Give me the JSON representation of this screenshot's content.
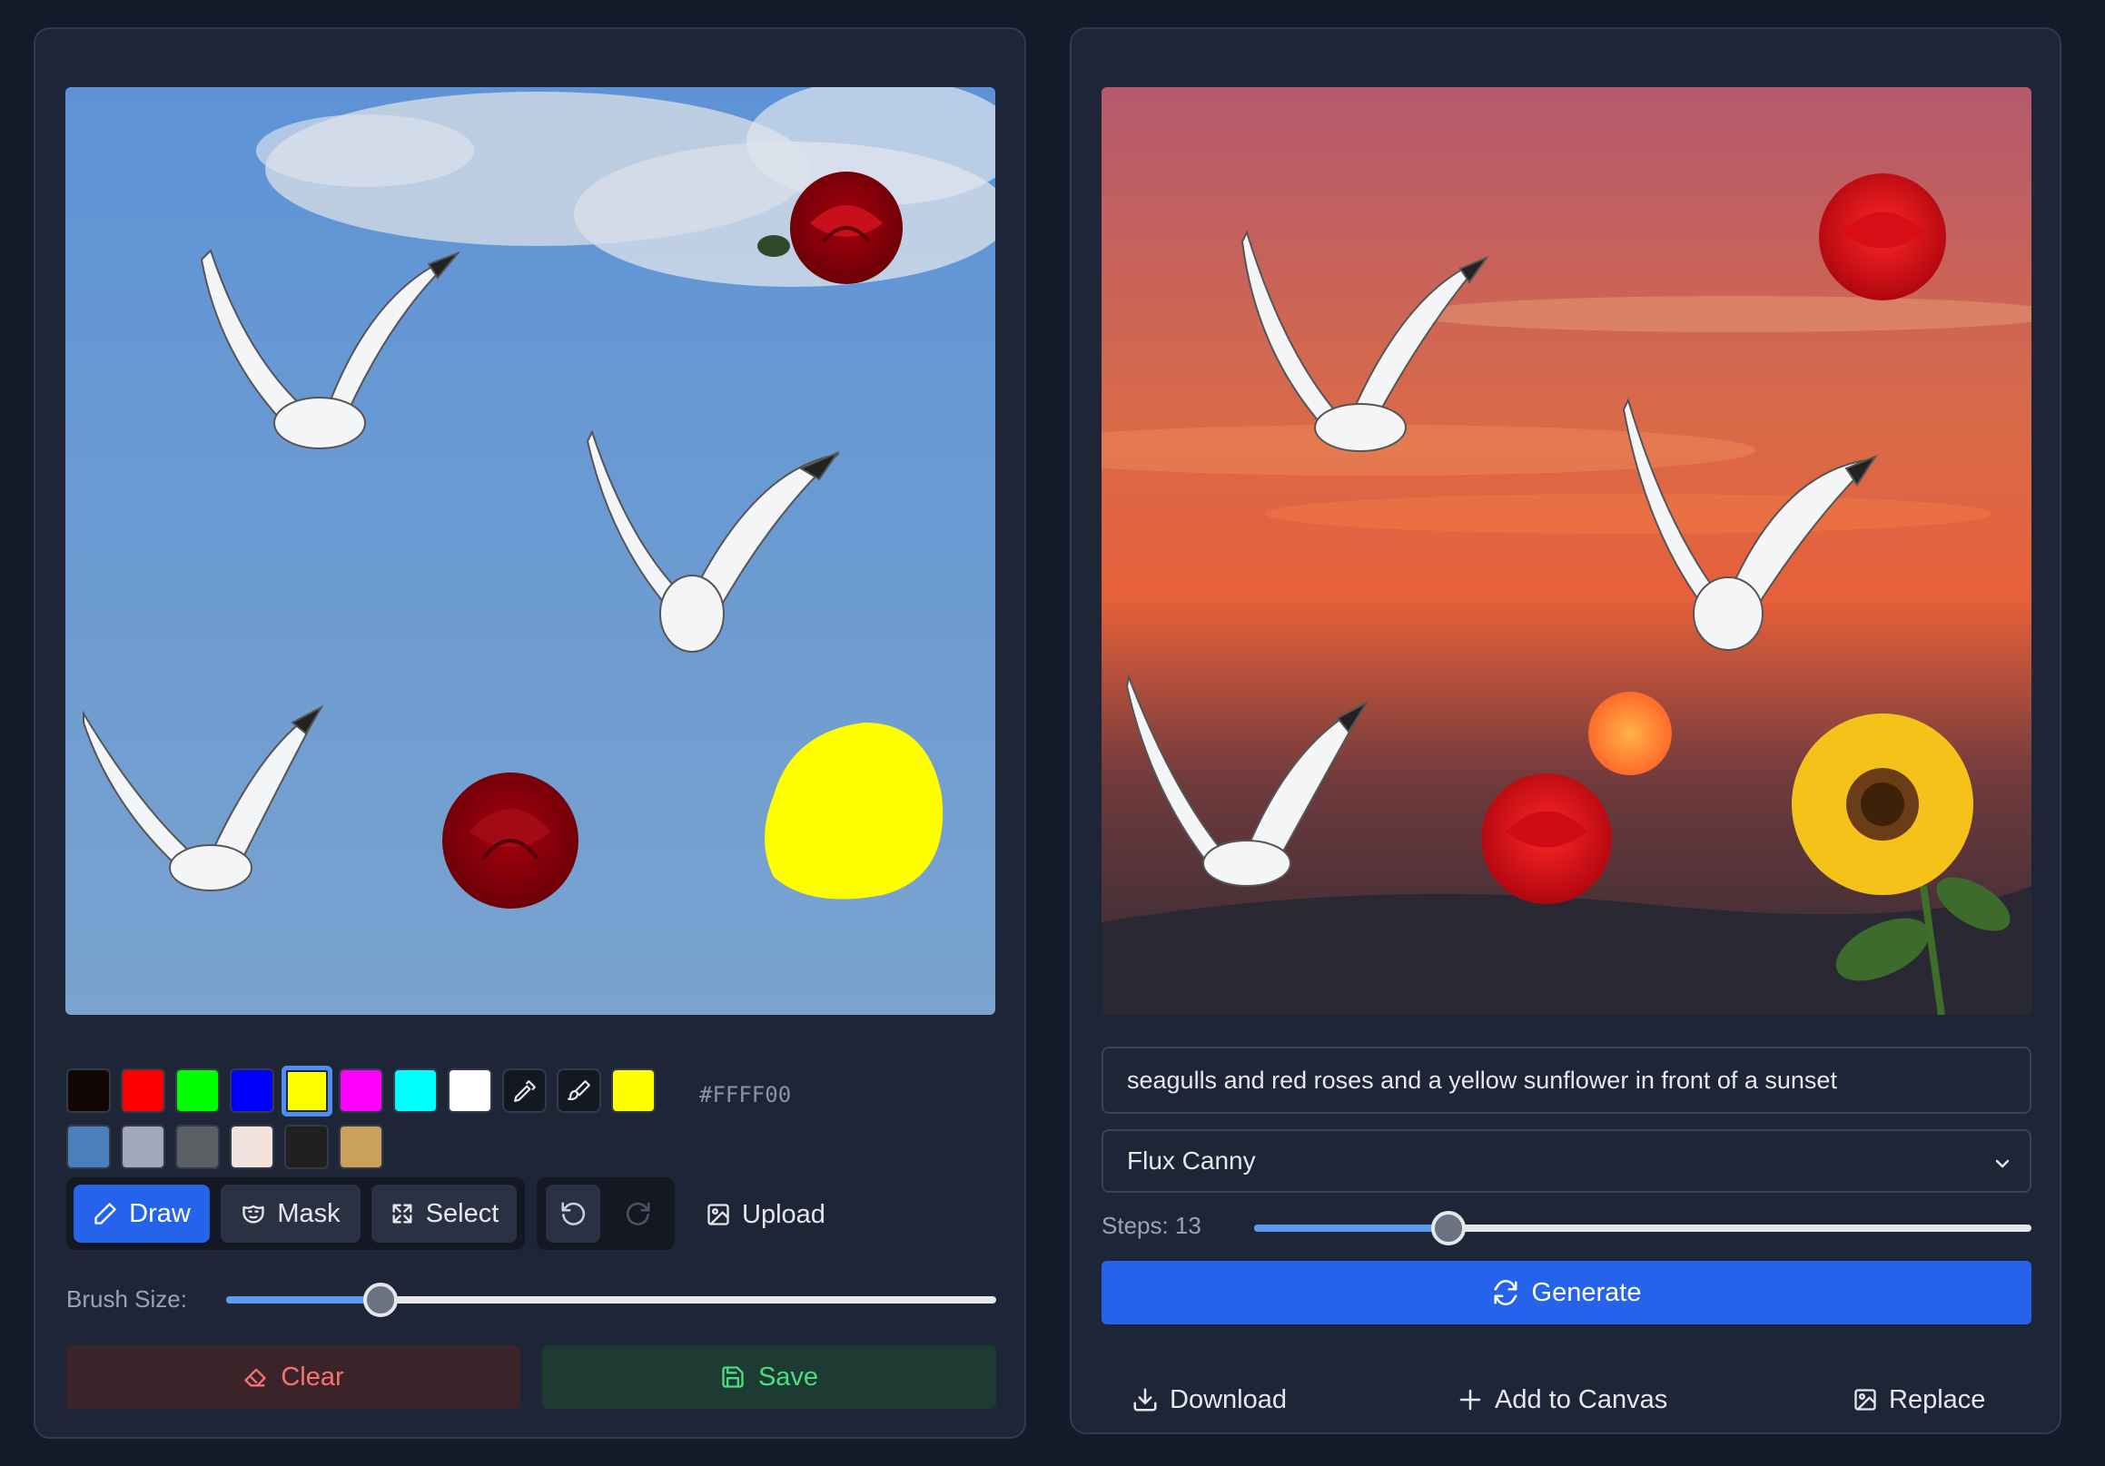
{
  "left_panel": {
    "palette": {
      "row1": [
        {
          "color": "#120607",
          "name": "black"
        },
        {
          "color": "#ff0000",
          "name": "red"
        },
        {
          "color": "#00ff00",
          "name": "green"
        },
        {
          "color": "#0000ff",
          "name": "blue"
        },
        {
          "color": "#ffff00",
          "name": "yellow",
          "selected": true
        },
        {
          "color": "#ff00ff",
          "name": "magenta"
        },
        {
          "color": "#00ffff",
          "name": "cyan"
        },
        {
          "color": "#ffffff",
          "name": "white"
        }
      ],
      "row2": [
        {
          "color": "#4a7fbd",
          "name": "steel-blue"
        },
        {
          "color": "#a0a8bb",
          "name": "gray-blue"
        },
        {
          "color": "#5b5e63",
          "name": "dark-gray"
        },
        {
          "color": "#f4e2dc",
          "name": "light-pink"
        },
        {
          "color": "#1f2121",
          "name": "near-black"
        },
        {
          "color": "#c9a15b",
          "name": "tan"
        }
      ],
      "current_color": "#ffff00",
      "current_hex": "#FFFF00"
    },
    "tools": {
      "draw": "Draw",
      "mask": "Mask",
      "select": "Select",
      "upload": "Upload"
    },
    "brush_size_label": "Brush Size:",
    "brush_size_value": 0.2,
    "clear_label": "Clear",
    "save_label": "Save"
  },
  "right_panel": {
    "prompt_value": "seagulls and red roses and a yellow sunflower in front of a sunset",
    "model_selected": "Flux Canny",
    "steps_label": "Steps: 13",
    "steps_value": 13,
    "steps_fraction": 0.25,
    "generate_label": "Generate",
    "download_label": "Download",
    "add_to_canvas_label": "Add to Canvas",
    "replace_label": "Replace"
  },
  "colors": {
    "accent": "#2563eb",
    "clear_bg": "#3a2429",
    "clear_text": "#f87171",
    "save_bg": "#1d3a33",
    "save_text": "#4ade80"
  }
}
